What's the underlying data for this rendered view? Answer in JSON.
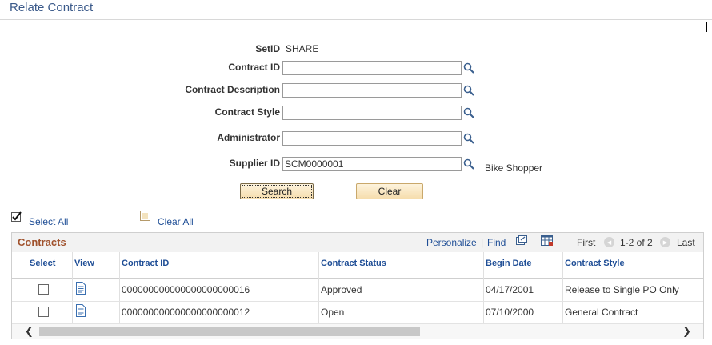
{
  "page": {
    "title": "Relate Contract"
  },
  "form": {
    "setid_label": "SetID",
    "setid_value": "SHARE",
    "contract_id_label": "Contract ID",
    "contract_id_value": "",
    "contract_desc_label": "Contract Description",
    "contract_desc_value": "",
    "contract_style_label": "Contract Style",
    "contract_style_value": "",
    "administrator_label": "Administrator",
    "administrator_value": "",
    "supplier_id_label": "Supplier ID",
    "supplier_id_value": "SCM0000001",
    "supplier_name": "Bike Shopper"
  },
  "buttons": {
    "search": "Search",
    "clear": "Clear"
  },
  "select_all": "Select All",
  "clear_all": "Clear All",
  "grid": {
    "title": "Contracts",
    "personalize": "Personalize",
    "separator": "|",
    "find": "Find",
    "first": "First",
    "range": "1-2 of 2",
    "last": "Last",
    "columns": [
      "Select",
      "View",
      "Contract ID",
      "Contract Status",
      "Begin Date",
      "Contract Style"
    ],
    "rows": [
      {
        "contract_id": "000000000000000000000016",
        "status": "Approved",
        "begin_date": "04/17/2001",
        "style": "Release to Single PO Only",
        "selected": false
      },
      {
        "contract_id": "000000000000000000000012",
        "status": "Open",
        "begin_date": "07/10/2000",
        "style": "General Contract",
        "selected": false
      }
    ]
  },
  "icons": {
    "lookup": "magnifier-icon",
    "view": "document-icon",
    "new_window": "new-window-icon",
    "download": "spreadsheet-icon"
  }
}
